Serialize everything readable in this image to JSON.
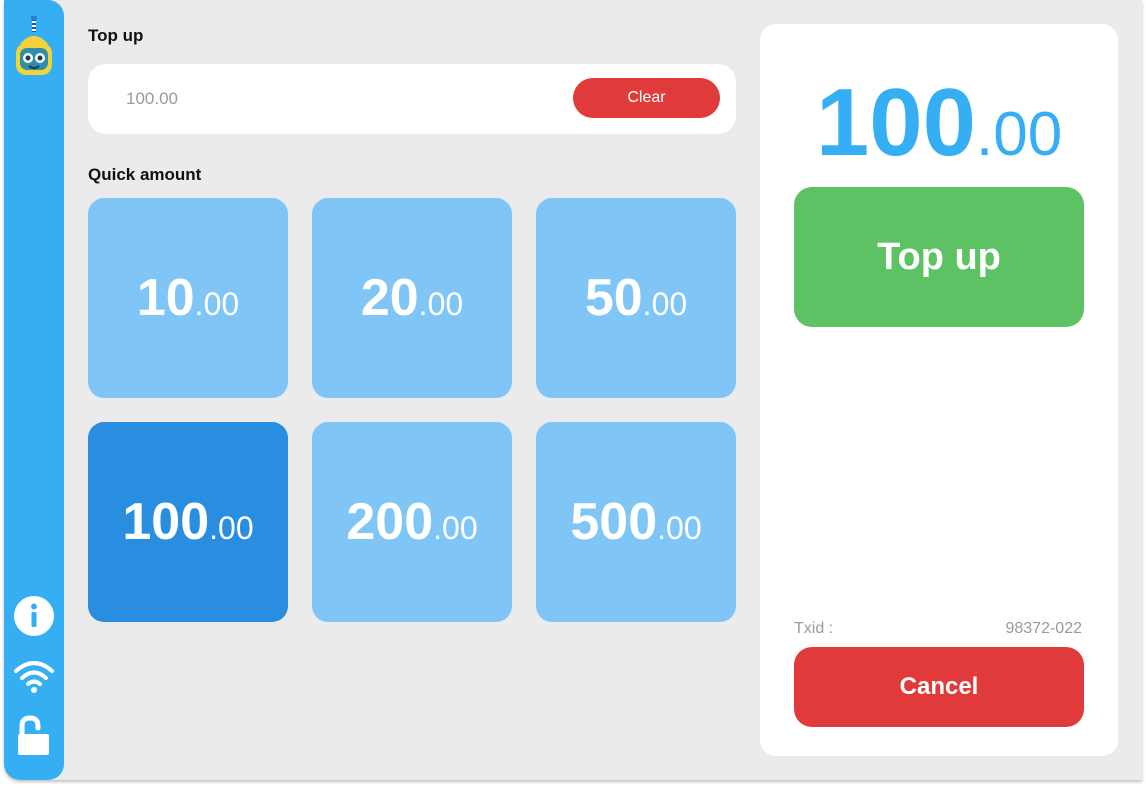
{
  "sidebar": {
    "logo_icon": "robot-mascot-icon",
    "items": [
      {
        "icon": "info-icon"
      },
      {
        "icon": "wifi-icon"
      },
      {
        "icon": "unlock-icon"
      }
    ]
  },
  "topup_section": {
    "label": "Top up",
    "input_placeholder": "100.00",
    "input_value": "",
    "clear_label": "Clear"
  },
  "quick_amount": {
    "label": "Quick amount",
    "tiles": [
      {
        "int": "10",
        "dec": ".00"
      },
      {
        "int": "20",
        "dec": ".00"
      },
      {
        "int": "50",
        "dec": ".00"
      },
      {
        "int": "100",
        "dec": ".00",
        "selected": true
      },
      {
        "int": "200",
        "dec": ".00"
      },
      {
        "int": "500",
        "dec": ".00"
      }
    ]
  },
  "summary": {
    "amount_int": "100",
    "amount_dec": ".00",
    "topup_label": "Top up",
    "txid_label": "Txid :",
    "txid_value": "98372-022",
    "cancel_label": "Cancel"
  },
  "colors": {
    "accent": "#35aef4",
    "tile": "#7fc6f6",
    "tile_selected": "#2a8ee0",
    "success": "#5cc263",
    "danger": "#e03a3a",
    "background": "#ebebeb"
  }
}
